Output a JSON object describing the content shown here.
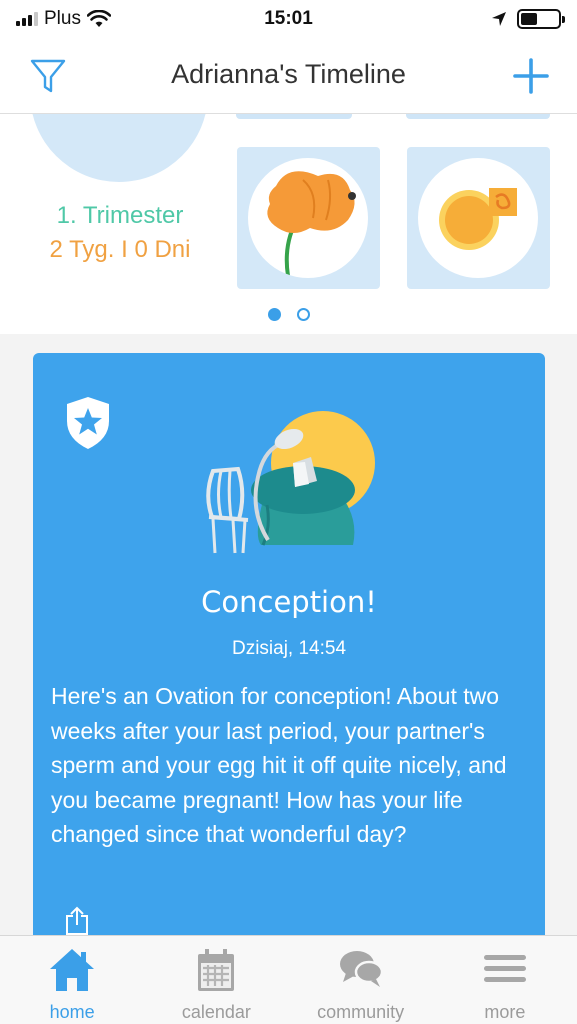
{
  "status_bar": {
    "carrier": "Plus",
    "time": "15:01",
    "signal_bars": 4,
    "signal_filled": 3,
    "battery_level": 0.45
  },
  "header": {
    "title": "Adrianna's Timeline",
    "filter_icon": "filter-icon",
    "add_icon": "plus-icon"
  },
  "carousel": {
    "trimester": "1. Trimester",
    "duration": "2 Tyg. I 0 Dni",
    "cards": [
      {
        "icon": "poppy-flower-icon"
      },
      {
        "icon": "egg-cell-icon"
      }
    ],
    "page_count": 2,
    "active_page": 0
  },
  "ovation": {
    "badge_icon": "star-shield-icon",
    "illustration": "cafe-table-illustration",
    "title": "Conception!",
    "date": "Dzisiaj, 14:54",
    "body": "Here's an Ovation for conception! About two weeks after your last period, your partner's sperm and your egg hit it off quite nicely, and you became pregnant! How has your life changed since that wonderful day?",
    "share_icon": "share-icon"
  },
  "tabs": [
    {
      "label": "home",
      "icon": "home-icon",
      "active": true
    },
    {
      "label": "calendar",
      "icon": "calendar-icon",
      "active": false
    },
    {
      "label": "community",
      "icon": "chat-bubbles-icon",
      "active": false
    },
    {
      "label": "more",
      "icon": "menu-icon",
      "active": false
    }
  ],
  "colors": {
    "accent": "#3b9fe8",
    "card_bg": "#3ea3ec",
    "trimester": "#4fc8a7",
    "duration": "#f0a142",
    "tile_bg": "#d4e8f8"
  }
}
